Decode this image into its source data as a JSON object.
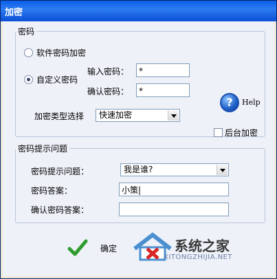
{
  "window": {
    "title": "加密"
  },
  "password_group": {
    "legend": "密码",
    "radio_software": "软件密码加密",
    "radio_custom": "自定义密码",
    "label_enter": "输入密码：",
    "label_confirm": "确认密码：",
    "enter_value": "*",
    "confirm_value": "*",
    "help_label": "Help",
    "type_label": "加密类型选择",
    "type_selected": "快速加密",
    "background_label": "后台加密"
  },
  "hint_group": {
    "legend": "密码提示问题",
    "question_label": "密码提示问题：",
    "question_selected": "我是谁?",
    "answer_label": "密码答案：",
    "answer_value": "小策|",
    "confirm_answer_label": "确认密码答案：",
    "confirm_answer_value": ""
  },
  "footer": {
    "ok_label": "确定"
  },
  "watermark": {
    "text_cn": "系统之家",
    "text_en": "XITONGZHIJIA.NET"
  }
}
